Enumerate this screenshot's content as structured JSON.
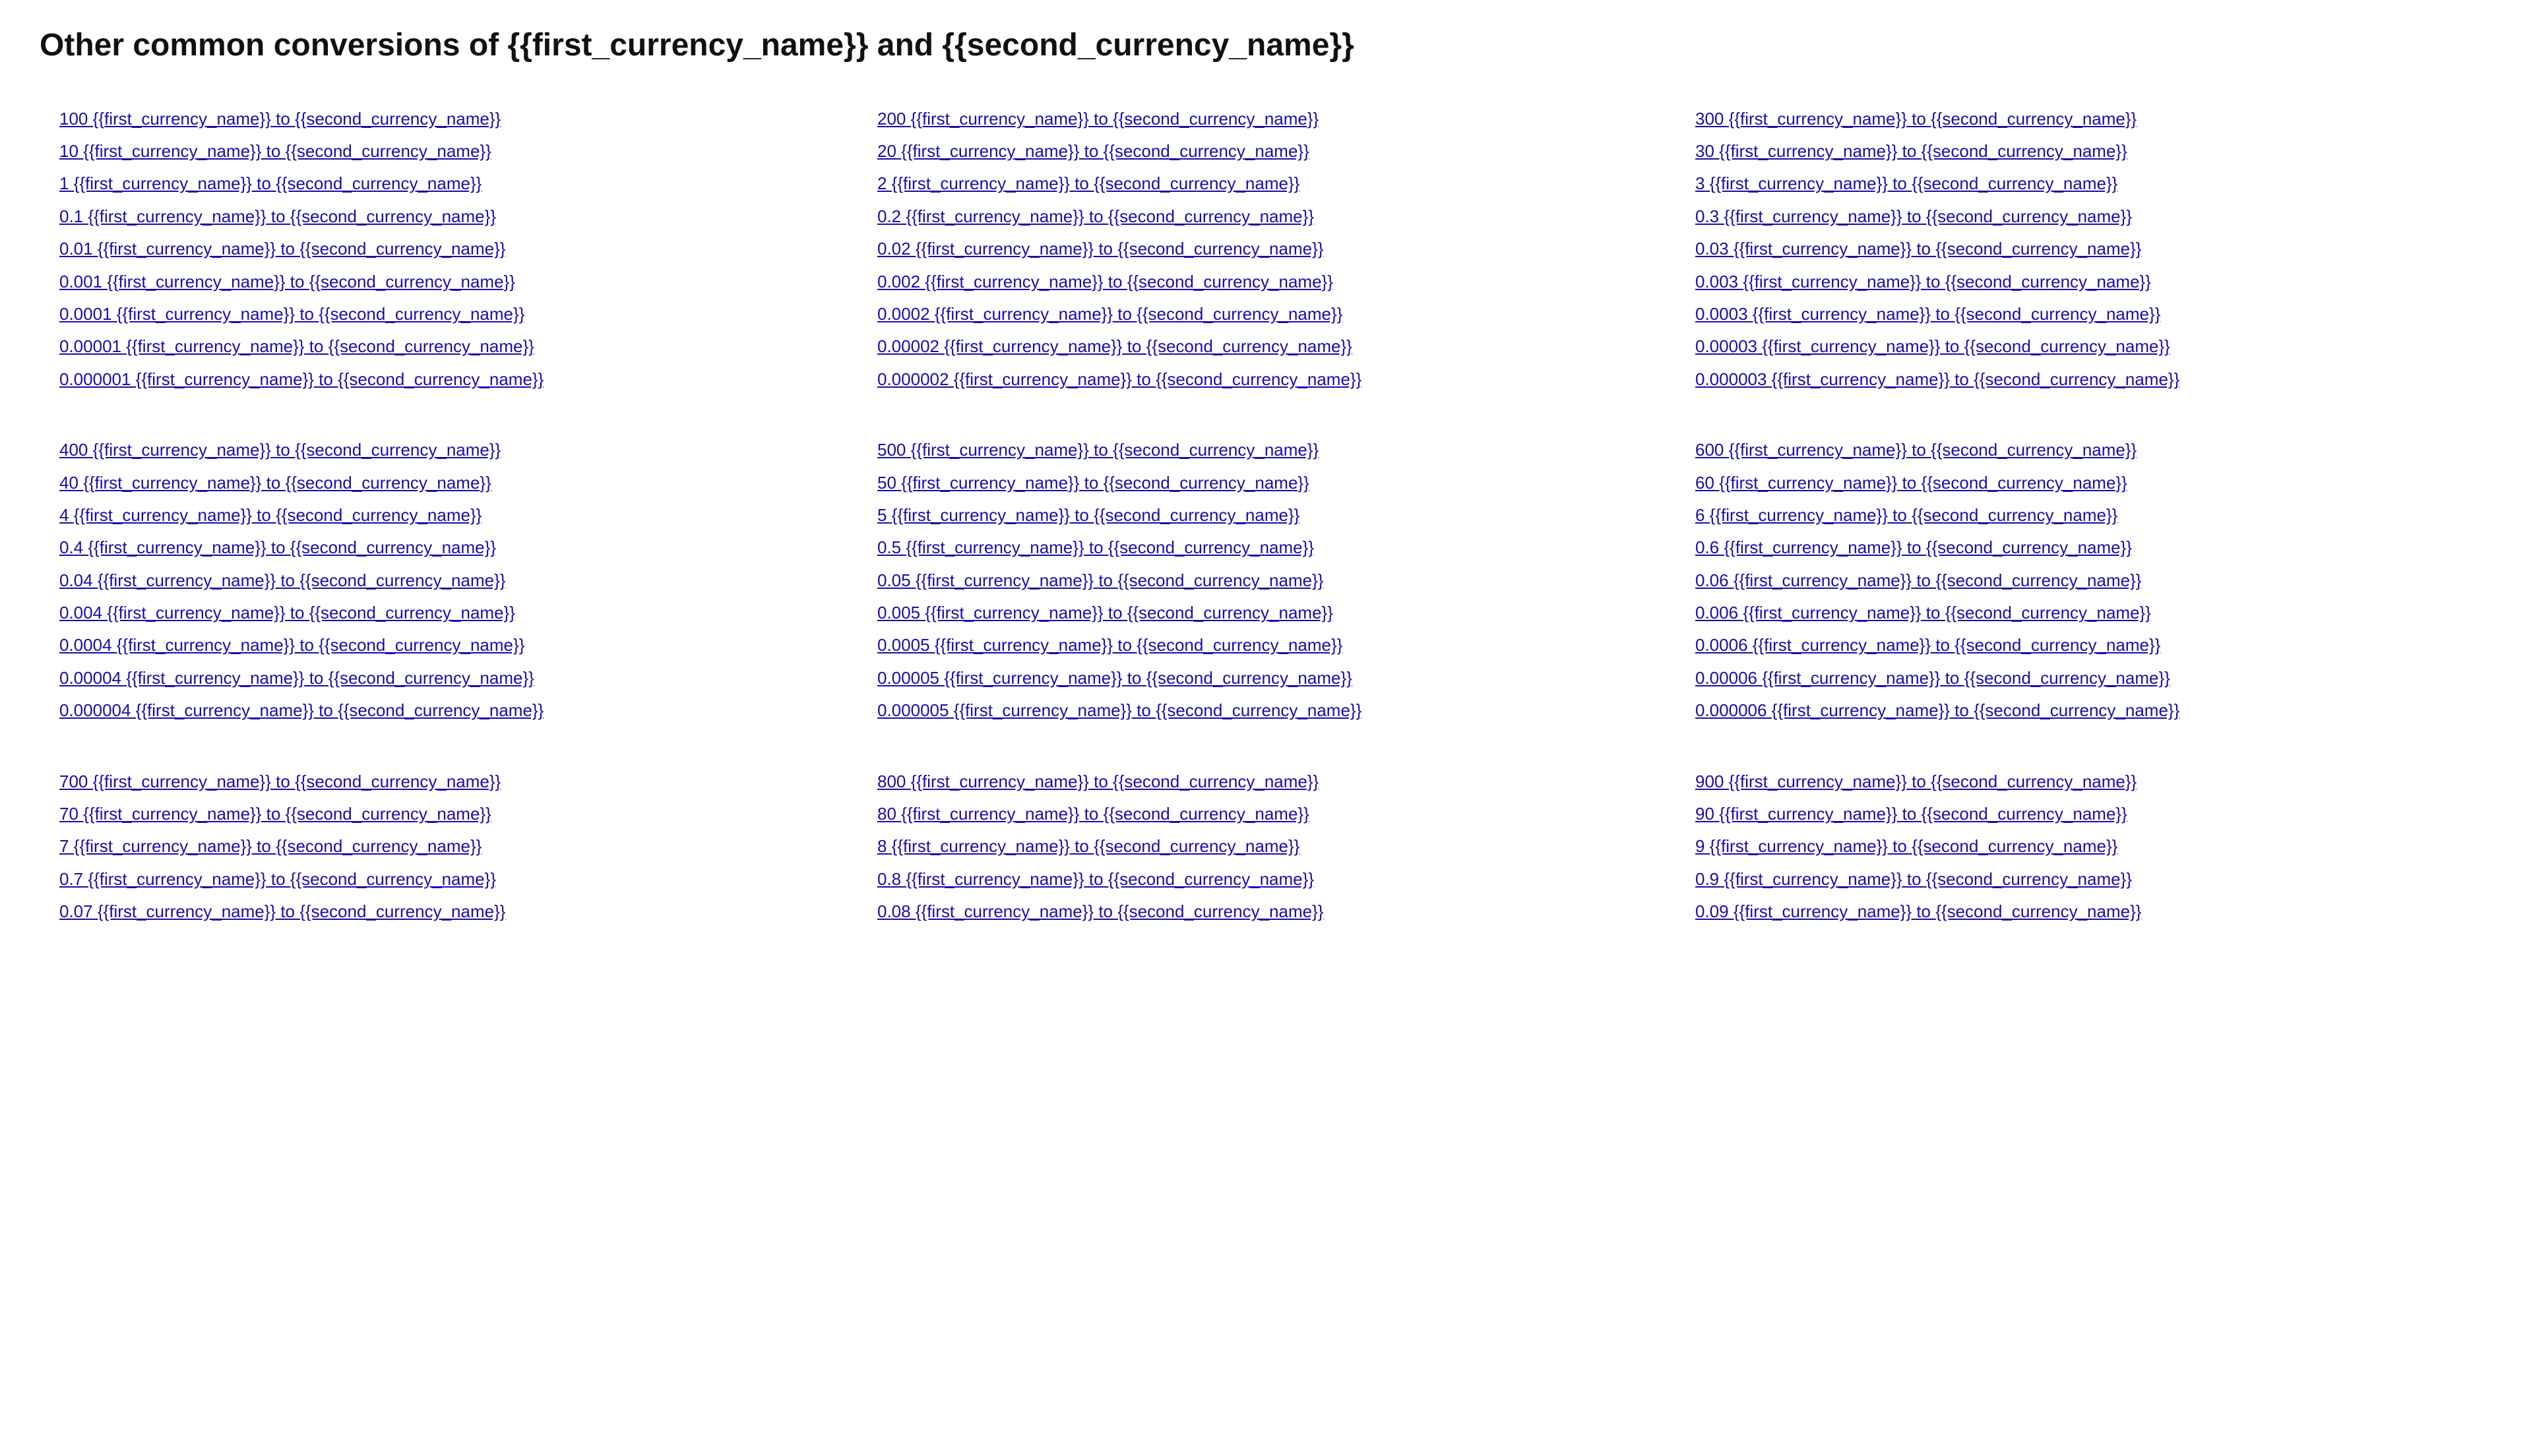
{
  "page": {
    "title": "Other common conversions of {{first_currency_name}} and {{second_currency_name}}"
  },
  "sections": [
    {
      "id": "section-1",
      "columns": [
        {
          "id": "col-1-1",
          "links": [
            "100 {{first_currency_name}} to {{second_currency_name}}",
            "10 {{first_currency_name}} to {{second_currency_name}}",
            "1 {{first_currency_name}} to {{second_currency_name}}",
            "0.1 {{first_currency_name}} to {{second_currency_name}}",
            "0.01 {{first_currency_name}} to {{second_currency_name}}",
            "0.001 {{first_currency_name}} to {{second_currency_name}}",
            "0.0001 {{first_currency_name}} to {{second_currency_name}}",
            "0.00001 {{first_currency_name}} to {{second_currency_name}}",
            "0.000001 {{first_currency_name}} to {{second_currency_name}}"
          ]
        },
        {
          "id": "col-1-2",
          "links": [
            "200 {{first_currency_name}} to {{second_currency_name}}",
            "20 {{first_currency_name}} to {{second_currency_name}}",
            "2 {{first_currency_name}} to {{second_currency_name}}",
            "0.2 {{first_currency_name}} to {{second_currency_name}}",
            "0.02 {{first_currency_name}} to {{second_currency_name}}",
            "0.002 {{first_currency_name}} to {{second_currency_name}}",
            "0.0002 {{first_currency_name}} to {{second_currency_name}}",
            "0.00002 {{first_currency_name}} to {{second_currency_name}}",
            "0.000002 {{first_currency_name}} to {{second_currency_name}}"
          ]
        },
        {
          "id": "col-1-3",
          "links": [
            "300 {{first_currency_name}} to {{second_currency_name}}",
            "30 {{first_currency_name}} to {{second_currency_name}}",
            "3 {{first_currency_name}} to {{second_currency_name}}",
            "0.3 {{first_currency_name}} to {{second_currency_name}}",
            "0.03 {{first_currency_name}} to {{second_currency_name}}",
            "0.003 {{first_currency_name}} to {{second_currency_name}}",
            "0.0003 {{first_currency_name}} to {{second_currency_name}}",
            "0.00003 {{first_currency_name}} to {{second_currency_name}}",
            "0.000003 {{first_currency_name}} to {{second_currency_name}}"
          ]
        }
      ]
    },
    {
      "id": "section-2",
      "columns": [
        {
          "id": "col-2-1",
          "links": [
            "400 {{first_currency_name}} to {{second_currency_name}}",
            "40 {{first_currency_name}} to {{second_currency_name}}",
            "4 {{first_currency_name}} to {{second_currency_name}}",
            "0.4 {{first_currency_name}} to {{second_currency_name}}",
            "0.04 {{first_currency_name}} to {{second_currency_name}}",
            "0.004 {{first_currency_name}} to {{second_currency_name}}",
            "0.0004 {{first_currency_name}} to {{second_currency_name}}",
            "0.00004 {{first_currency_name}} to {{second_currency_name}}",
            "0.000004 {{first_currency_name}} to {{second_currency_name}}"
          ]
        },
        {
          "id": "col-2-2",
          "links": [
            "500 {{first_currency_name}} to {{second_currency_name}}",
            "50 {{first_currency_name}} to {{second_currency_name}}",
            "5 {{first_currency_name}} to {{second_currency_name}}",
            "0.5 {{first_currency_name}} to {{second_currency_name}}",
            "0.05 {{first_currency_name}} to {{second_currency_name}}",
            "0.005 {{first_currency_name}} to {{second_currency_name}}",
            "0.0005 {{first_currency_name}} to {{second_currency_name}}",
            "0.00005 {{first_currency_name}} to {{second_currency_name}}",
            "0.000005 {{first_currency_name}} to {{second_currency_name}}"
          ]
        },
        {
          "id": "col-2-3",
          "links": [
            "600 {{first_currency_name}} to {{second_currency_name}}",
            "60 {{first_currency_name}} to {{second_currency_name}}",
            "6 {{first_currency_name}} to {{second_currency_name}}",
            "0.6 {{first_currency_name}} to {{second_currency_name}}",
            "0.06 {{first_currency_name}} to {{second_currency_name}}",
            "0.006 {{first_currency_name}} to {{second_currency_name}}",
            "0.0006 {{first_currency_name}} to {{second_currency_name}}",
            "0.00006 {{first_currency_name}} to {{second_currency_name}}",
            "0.000006 {{first_currency_name}} to {{second_currency_name}}"
          ]
        }
      ]
    },
    {
      "id": "section-3",
      "columns": [
        {
          "id": "col-3-1",
          "links": [
            "700 {{first_currency_name}} to {{second_currency_name}}",
            "70 {{first_currency_name}} to {{second_currency_name}}",
            "7 {{first_currency_name}} to {{second_currency_name}}",
            "0.7 {{first_currency_name}} to {{second_currency_name}}",
            "0.07 {{first_currency_name}} to {{second_currency_name}}"
          ]
        },
        {
          "id": "col-3-2",
          "links": [
            "800 {{first_currency_name}} to {{second_currency_name}}",
            "80 {{first_currency_name}} to {{second_currency_name}}",
            "8 {{first_currency_name}} to {{second_currency_name}}",
            "0.8 {{first_currency_name}} to {{second_currency_name}}",
            "0.08 {{first_currency_name}} to {{second_currency_name}}"
          ]
        },
        {
          "id": "col-3-3",
          "links": [
            "900 {{first_currency_name}} to {{second_currency_name}}",
            "90 {{first_currency_name}} to {{second_currency_name}}",
            "9 {{first_currency_name}} to {{second_currency_name}}",
            "0.9 {{first_currency_name}} to {{second_currency_name}}",
            "0.09 {{first_currency_name}} to {{second_currency_name}}"
          ]
        }
      ]
    }
  ]
}
